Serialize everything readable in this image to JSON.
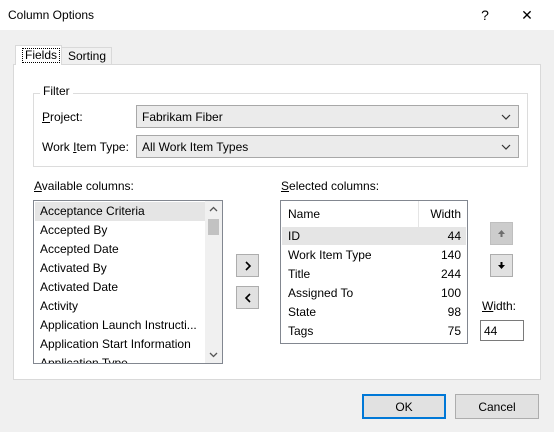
{
  "window": {
    "title": "Column Options",
    "help_label": "?",
    "close_label": "✕"
  },
  "tabs": [
    {
      "label": "Fields",
      "active": true
    },
    {
      "label": "Sorting",
      "active": false
    }
  ],
  "filter": {
    "legend": "Filter",
    "project_label_pre": "",
    "project_label_ul": "P",
    "project_label_post": "roject:",
    "project_value": "Fabrikam Fiber",
    "wit_label_pre": "Work ",
    "wit_label_ul": "I",
    "wit_label_post": "tem Type:",
    "wit_value": "All Work Item Types"
  },
  "available": {
    "label_ul": "A",
    "label_post": "vailable columns:",
    "items": [
      "Acceptance Criteria",
      "Accepted By",
      "Accepted Date",
      "Activated By",
      "Activated Date",
      "Activity",
      "Application Launch Instructi...",
      "Application Start Information",
      "Application Type"
    ],
    "selected_index": 0
  },
  "move_buttons": {
    "add": "›",
    "remove": "‹"
  },
  "selected": {
    "label_ul": "S",
    "label_post": "elected columns:",
    "headers": {
      "name": "Name",
      "width": "Width"
    },
    "rows": [
      {
        "name": "ID",
        "width": "44"
      },
      {
        "name": "Work Item Type",
        "width": "140"
      },
      {
        "name": "Title",
        "width": "244"
      },
      {
        "name": "Assigned To",
        "width": "100"
      },
      {
        "name": "State",
        "width": "98"
      },
      {
        "name": "Tags",
        "width": "75"
      }
    ],
    "selected_index": 0
  },
  "order_buttons": {
    "up": "▲",
    "down": "▼"
  },
  "width": {
    "label_pre": "",
    "label_ul": "W",
    "label_post": "idth:",
    "value": "44"
  },
  "footer": {
    "ok": "OK",
    "cancel": "Cancel"
  },
  "colors": {
    "accent": "#0078d7",
    "selection": "#e5e5e5"
  }
}
